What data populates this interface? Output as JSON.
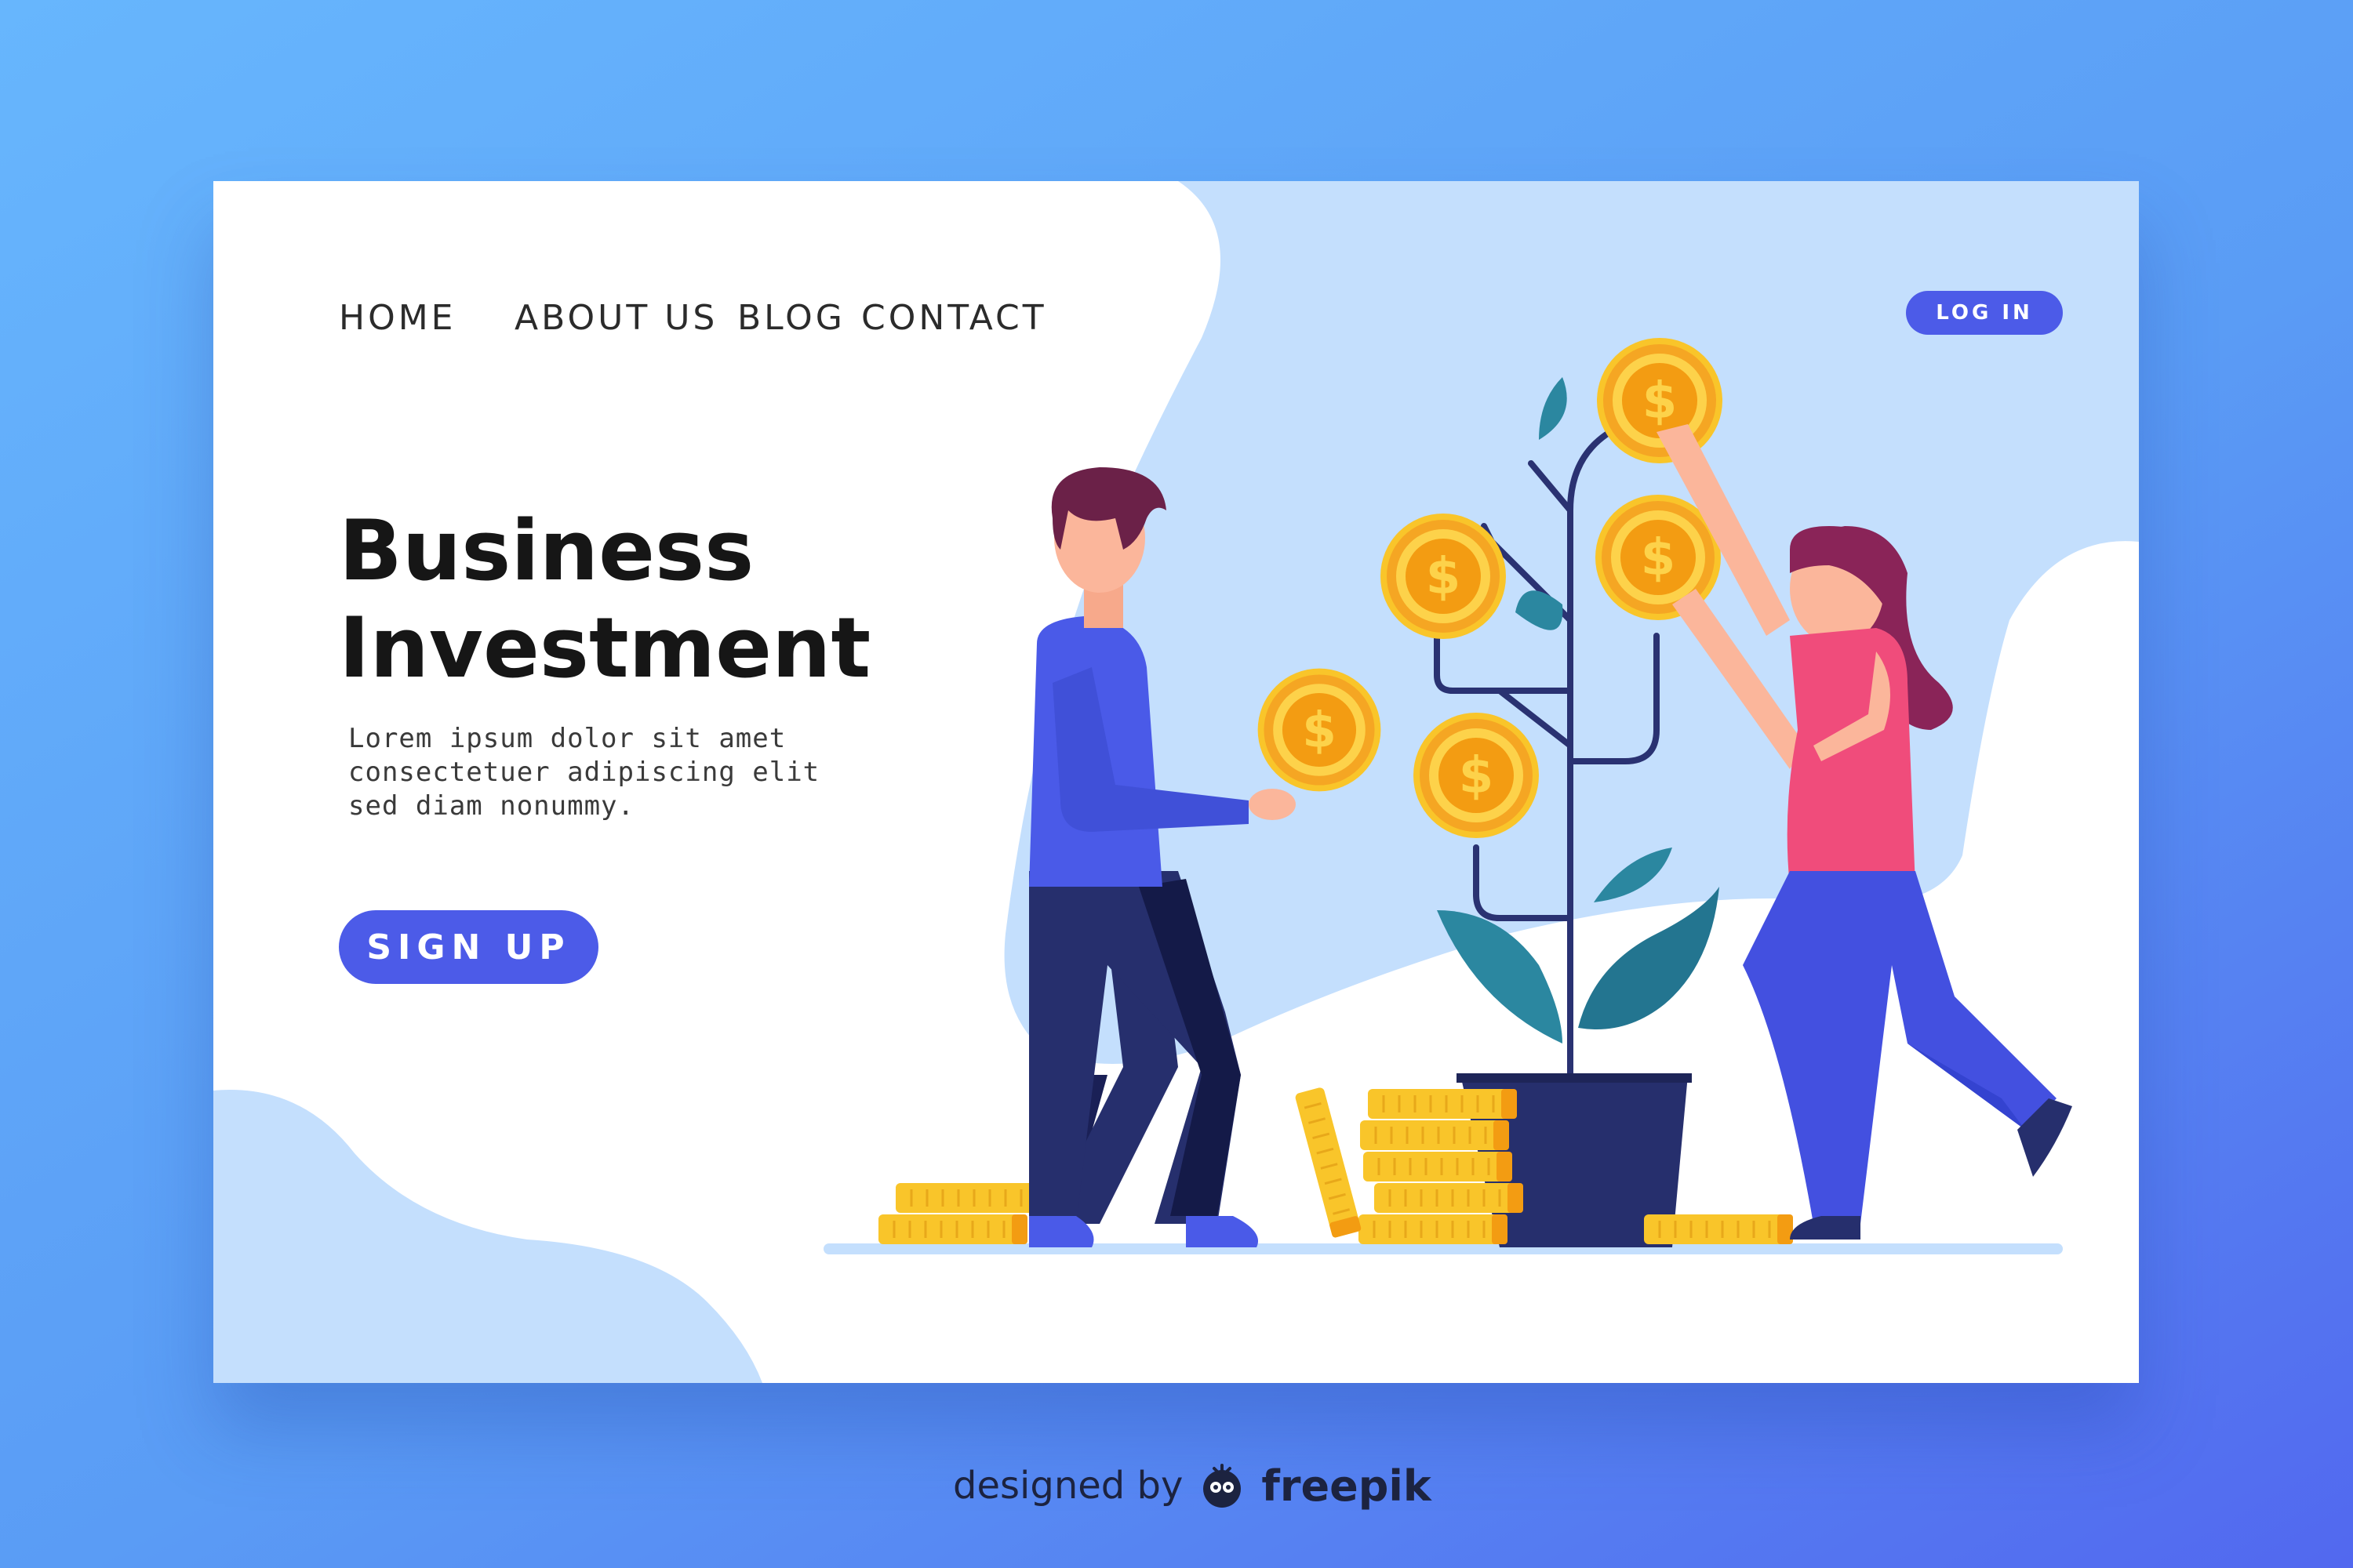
{
  "nav": {
    "links": [
      {
        "label": "HOME"
      },
      {
        "label": "ABOUT US"
      },
      {
        "label": "BLOG"
      },
      {
        "label": "CONTACT"
      }
    ],
    "login_label": "LOG IN"
  },
  "hero": {
    "title_line1": "Business",
    "title_line2": "Investment",
    "body_lines": [
      "Lorem ipsum dolor sit amet",
      "consectetuer adipiscing elit",
      "sed diam nonummy."
    ],
    "signup_label": "SIGN  UP"
  },
  "credit": {
    "text": "designed by",
    "brand": "freepik"
  },
  "icons": {
    "coin": "dollar-coin-icon",
    "brand": "freepik-logo-icon"
  },
  "coin_symbol": "$",
  "colors": {
    "accent": "#4c5be8",
    "background_top": "#67b6fd",
    "background_bottom": "#5268ef",
    "blob": "#c4dffd",
    "coin_gold": "#f9c52a",
    "man_shirt": "#4a5ae8",
    "man_pants": "#262f6d",
    "woman_top": "#f04c7b",
    "woman_pants": "#4350e0",
    "plant_pot": "#262f6d",
    "leaf": "#2b87a0"
  }
}
